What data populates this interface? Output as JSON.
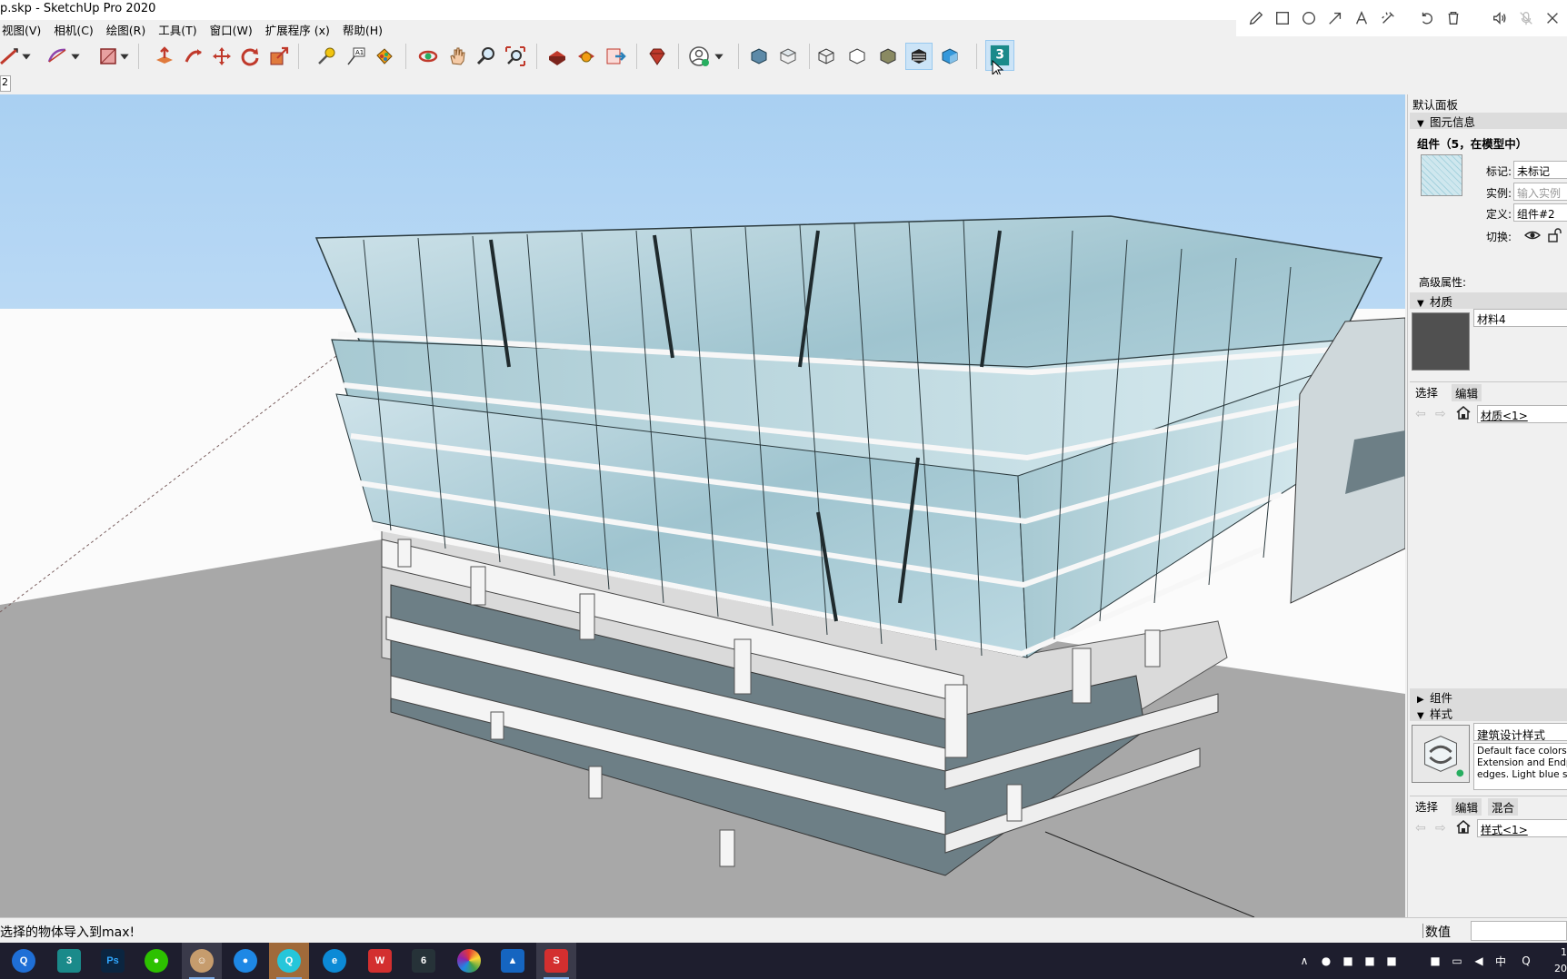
{
  "window": {
    "title": "p.skp - SketchUp Pro 2020"
  },
  "menu": [
    {
      "label": "视图(V)"
    },
    {
      "label": "相机(C)"
    },
    {
      "label": "绘图(R)"
    },
    {
      "label": "工具(T)"
    },
    {
      "label": "窗口(W)"
    },
    {
      "label": "扩展程序 (x)"
    },
    {
      "label": "帮助(H)"
    }
  ],
  "annotate_tools": [
    "pencil-icon",
    "rectangle-icon",
    "circle-icon",
    "arrow-icon",
    "text-icon",
    "highlighter-icon",
    "undo-icon",
    "trash-icon",
    "speaker-icon",
    "mic-muted-icon",
    "close-icon"
  ],
  "tabs": {
    "scene_tab": "2"
  },
  "panel": {
    "title": "默认面板",
    "entity_info": {
      "header": "图元信息",
      "entity_title": "组件（5，在模型中）",
      "tag_label": "标记:",
      "tag_value": "未标记",
      "instance_label": "实例:",
      "instance_placeholder": "输入实例",
      "definition_label": "定义:",
      "definition_value": "组件#2",
      "toggle_label": "切换:",
      "advanced_label": "高级属性:"
    },
    "materials": {
      "header": "材质",
      "name": "材料4",
      "tab_select": "选择",
      "tab_edit": "编辑",
      "library": "材质<1>",
      "swatch_color": "#505050"
    },
    "components": {
      "header": "组件"
    },
    "styles": {
      "header": "样式",
      "style_name": "建筑设计样式",
      "desc_line1": "Default face colors. B",
      "desc_line2": "Extension and Endpoi",
      "desc_line3": "edges. Light blue sky",
      "tab_select": "选择",
      "tab_edit": "编辑",
      "tab_mix": "混合",
      "library": "样式<1>"
    }
  },
  "status": {
    "message": "选择的物体导入到max!",
    "measure_label": "数值"
  },
  "taskbar": {
    "apps": [
      "qq-browser-icon",
      "3dsmax-icon",
      "photoshop-icon",
      "wechat-icon",
      "avatar-app-icon",
      "media-app-icon",
      "qq-icon",
      "edge-icon",
      "wps-icon",
      "brush-app-icon",
      "color-app-icon",
      "photos-icon",
      "sketchup-icon"
    ],
    "ime": "中",
    "clock_line1": "1",
    "clock_line2": "20"
  }
}
